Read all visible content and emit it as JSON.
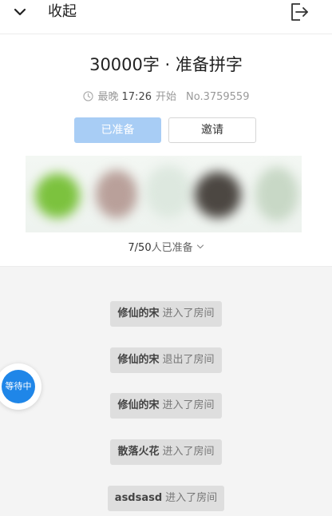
{
  "header": {
    "collapse_label": "收起",
    "collapse_icon": "chevron-down-icon",
    "exit_icon": "exit-icon"
  },
  "room": {
    "title": "30000字 · 准备拼字",
    "start_prefix": "最晚",
    "start_time": "17:26",
    "start_suffix": "开始",
    "room_number": "No.3759559",
    "ready_button": "已准备",
    "invite_button": "邀请",
    "ready_count": "7/50",
    "ready_count_suffix": "人已准备"
  },
  "messages": [
    {
      "name": "修仙的宋",
      "action": "进入了房间"
    },
    {
      "name": "修仙的宋",
      "action": "退出了房间"
    },
    {
      "name": "修仙的宋",
      "action": "进入了房间"
    },
    {
      "name": "散落火花",
      "action": "进入了房间"
    },
    {
      "name": "asdsasd",
      "action": "进入了房间"
    }
  ],
  "status_bubble": {
    "label": "等待中"
  },
  "colors": {
    "accent": "#1f86e8",
    "ready_button_bg": "#a8cdf5",
    "message_pill_bg": "#dedede"
  }
}
